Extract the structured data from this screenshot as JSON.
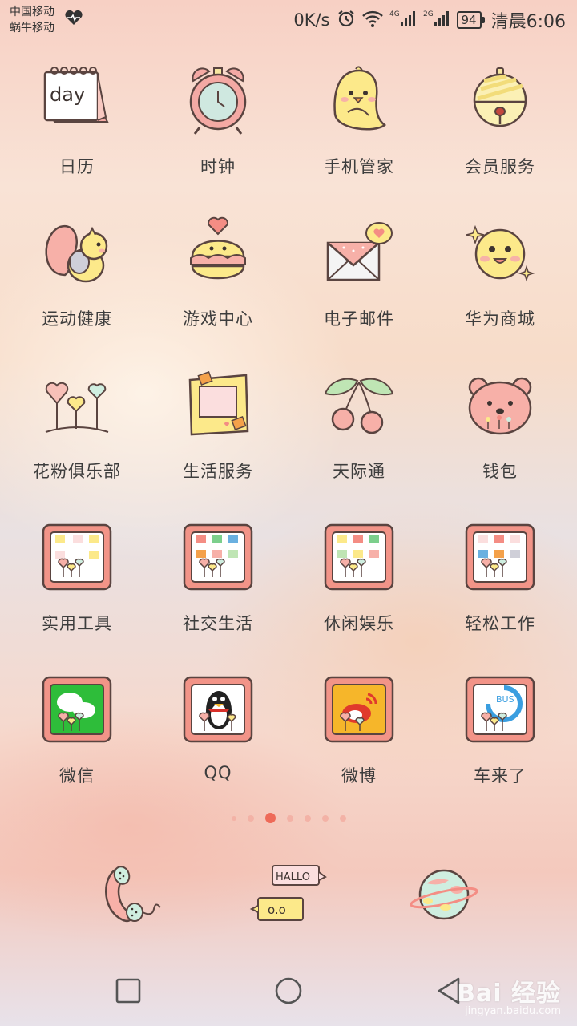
{
  "status_bar": {
    "carrier_1": "中国移动",
    "carrier_2": "蜗牛移动",
    "net_speed": "0K/s",
    "battery": "94",
    "time": "清晨6:06"
  },
  "apps": [
    {
      "label": "日历",
      "icon": "calendar-icon"
    },
    {
      "label": "时钟",
      "icon": "alarm-clock-icon"
    },
    {
      "label": "手机管家",
      "icon": "chick-icon"
    },
    {
      "label": "会员服务",
      "icon": "bell-icon"
    },
    {
      "label": "运动健康",
      "icon": "squirrel-icon"
    },
    {
      "label": "游戏中心",
      "icon": "macaron-icon"
    },
    {
      "label": "电子邮件",
      "icon": "envelope-icon"
    },
    {
      "label": "华为商城",
      "icon": "smiley-icon"
    },
    {
      "label": "花粉俱乐部",
      "icon": "heart-balloons-icon"
    },
    {
      "label": "生活服务",
      "icon": "photo-frame-icon"
    },
    {
      "label": "天际通",
      "icon": "cherry-icon"
    },
    {
      "label": "钱包",
      "icon": "bear-icon"
    },
    {
      "label": "实用工具",
      "icon": "folder-icon"
    },
    {
      "label": "社交生活",
      "icon": "folder-icon"
    },
    {
      "label": "休闲娱乐",
      "icon": "folder-icon"
    },
    {
      "label": "轻松工作",
      "icon": "folder-icon"
    },
    {
      "label": "微信",
      "icon": "wechat-icon"
    },
    {
      "label": "QQ",
      "icon": "qq-icon"
    },
    {
      "label": "微博",
      "icon": "weibo-icon"
    },
    {
      "label": "车来了",
      "icon": "bus-icon"
    }
  ],
  "page_indicator": {
    "count": 7,
    "active": 2
  },
  "dock": [
    {
      "icon": "phone-icon"
    },
    {
      "icon": "messages-icon",
      "bubble_top": "HALLO",
      "bubble_bottom": "o.o"
    },
    {
      "icon": "planet-browser-icon"
    }
  ],
  "watermark": {
    "main": "Bai 经验",
    "sub": "jingyan.baidu.com"
  }
}
